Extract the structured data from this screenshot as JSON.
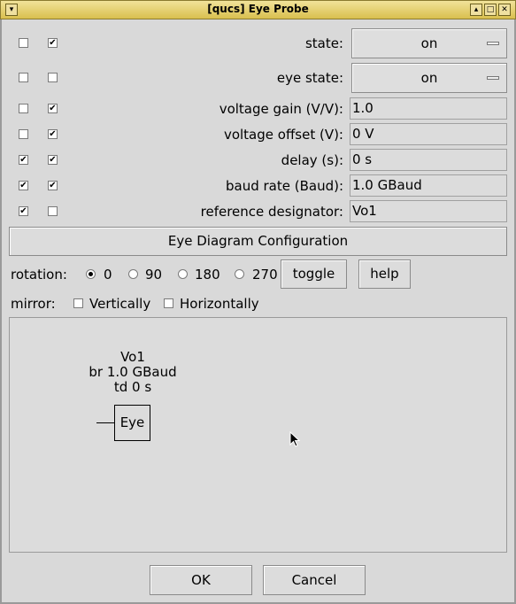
{
  "window": {
    "title": "[qucs] Eye Probe"
  },
  "properties": [
    {
      "label": "state:",
      "value": "on",
      "kind": "combo",
      "show": false,
      "display": true
    },
    {
      "label": "eye state:",
      "value": "on",
      "kind": "combo",
      "show": false,
      "display": false
    },
    {
      "label": "voltage gain (V/V):",
      "value": "1.0",
      "kind": "field",
      "show": false,
      "display": true
    },
    {
      "label": "voltage offset (V):",
      "value": "0 V",
      "kind": "field",
      "show": false,
      "display": true
    },
    {
      "label": "delay (s):",
      "value": "0 s",
      "kind": "field",
      "show": true,
      "display": true
    },
    {
      "label": "baud rate (Baud):",
      "value": "1.0 GBaud",
      "kind": "field",
      "show": true,
      "display": true
    },
    {
      "label": "reference designator:",
      "value": "Vo1",
      "kind": "field",
      "show": true,
      "display": false
    }
  ],
  "config_button": "Eye Diagram Configuration",
  "rotation": {
    "label": "rotation:",
    "options": [
      "0",
      "90",
      "180",
      "270"
    ],
    "selected": "0",
    "toggle_label": "toggle",
    "help_label": "help"
  },
  "mirror": {
    "label": "mirror:",
    "vertical": "Vertically",
    "horizontal": "Horizontally"
  },
  "preview": {
    "line1": "Vo1",
    "line2": "br 1.0 GBaud",
    "line3": "td 0 s",
    "symbol": "Eye"
  },
  "footer": {
    "ok": "OK",
    "cancel": "Cancel"
  }
}
